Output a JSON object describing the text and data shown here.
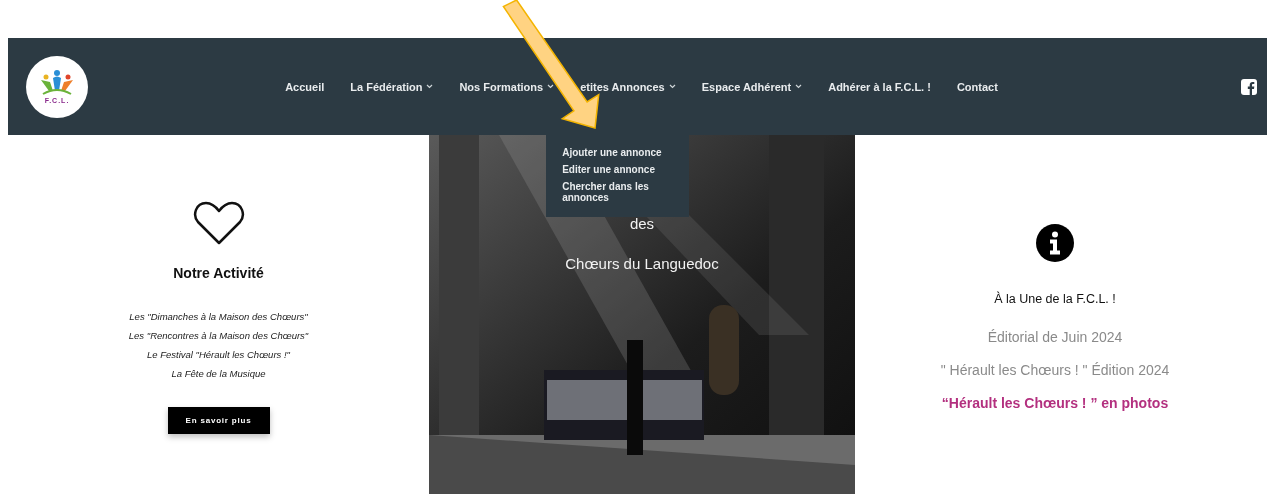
{
  "header": {
    "logo": {
      "text": "F.C.L."
    },
    "nav": [
      {
        "label": "Accueil",
        "kind": "link"
      },
      {
        "label": "La Fédération",
        "kind": "dropdown"
      },
      {
        "label": "Nos Formations",
        "kind": "dropdown"
      },
      {
        "label": "etites Annonces",
        "kind": "dropdown",
        "submenu": [
          "Ajouter une annonce",
          "Editer une annonce",
          "Chercher dans les annonces"
        ]
      },
      {
        "label": "Espace Adhérent",
        "kind": "dropdown"
      },
      {
        "label": "Adhérer à la F.C.L. !",
        "kind": "link"
      },
      {
        "label": "Contact",
        "kind": "link"
      }
    ]
  },
  "activity": {
    "title": "Notre Activité",
    "lines": [
      "Les \"Dimanches à la Maison des Chœurs\"",
      "Les \"Rencontres à la Maison des Chœurs\"",
      "Le Festival \"Hérault les Chœurs !\"",
      "La Fête de la Musique"
    ],
    "button": "En savoir plus"
  },
  "hero": {
    "kind": "picture",
    "lines": [
      "des",
      "Chœurs du Languedoc"
    ]
  },
  "news": {
    "title": "À la Une de la F.C.L. !",
    "links": [
      {
        "label": "Éditorial de Juin 2024",
        "color": "#8a8a8a"
      },
      {
        "label": "\" Hérault les Chœurs ! \"  Édition 2024",
        "color": "#8a8a8a"
      },
      {
        "label": "“Hérault les Chœurs ! ”  en photos",
        "color": "#b3307f"
      }
    ]
  }
}
